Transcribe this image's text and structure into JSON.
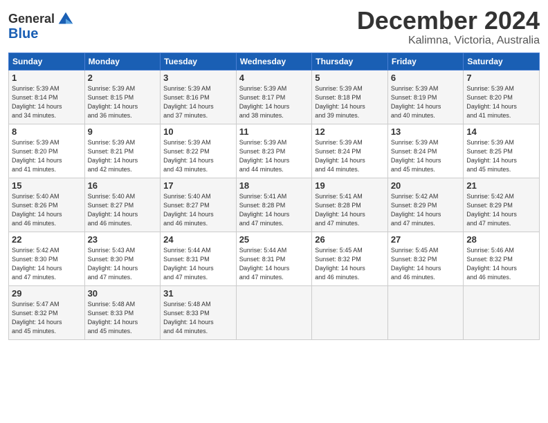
{
  "header": {
    "logo_line1": "General",
    "logo_line2": "Blue",
    "month": "December 2024",
    "location": "Kalimna, Victoria, Australia"
  },
  "days_of_week": [
    "Sunday",
    "Monday",
    "Tuesday",
    "Wednesday",
    "Thursday",
    "Friday",
    "Saturday"
  ],
  "weeks": [
    [
      {
        "day": 1,
        "info": "Sunrise: 5:39 AM\nSunset: 8:14 PM\nDaylight: 14 hours\nand 34 minutes."
      },
      {
        "day": 2,
        "info": "Sunrise: 5:39 AM\nSunset: 8:15 PM\nDaylight: 14 hours\nand 36 minutes."
      },
      {
        "day": 3,
        "info": "Sunrise: 5:39 AM\nSunset: 8:16 PM\nDaylight: 14 hours\nand 37 minutes."
      },
      {
        "day": 4,
        "info": "Sunrise: 5:39 AM\nSunset: 8:17 PM\nDaylight: 14 hours\nand 38 minutes."
      },
      {
        "day": 5,
        "info": "Sunrise: 5:39 AM\nSunset: 8:18 PM\nDaylight: 14 hours\nand 39 minutes."
      },
      {
        "day": 6,
        "info": "Sunrise: 5:39 AM\nSunset: 8:19 PM\nDaylight: 14 hours\nand 40 minutes."
      },
      {
        "day": 7,
        "info": "Sunrise: 5:39 AM\nSunset: 8:20 PM\nDaylight: 14 hours\nand 41 minutes."
      }
    ],
    [
      {
        "day": 8,
        "info": "Sunrise: 5:39 AM\nSunset: 8:20 PM\nDaylight: 14 hours\nand 41 minutes."
      },
      {
        "day": 9,
        "info": "Sunrise: 5:39 AM\nSunset: 8:21 PM\nDaylight: 14 hours\nand 42 minutes."
      },
      {
        "day": 10,
        "info": "Sunrise: 5:39 AM\nSunset: 8:22 PM\nDaylight: 14 hours\nand 43 minutes."
      },
      {
        "day": 11,
        "info": "Sunrise: 5:39 AM\nSunset: 8:23 PM\nDaylight: 14 hours\nand 44 minutes."
      },
      {
        "day": 12,
        "info": "Sunrise: 5:39 AM\nSunset: 8:24 PM\nDaylight: 14 hours\nand 44 minutes."
      },
      {
        "day": 13,
        "info": "Sunrise: 5:39 AM\nSunset: 8:24 PM\nDaylight: 14 hours\nand 45 minutes."
      },
      {
        "day": 14,
        "info": "Sunrise: 5:39 AM\nSunset: 8:25 PM\nDaylight: 14 hours\nand 45 minutes."
      }
    ],
    [
      {
        "day": 15,
        "info": "Sunrise: 5:40 AM\nSunset: 8:26 PM\nDaylight: 14 hours\nand 46 minutes."
      },
      {
        "day": 16,
        "info": "Sunrise: 5:40 AM\nSunset: 8:27 PM\nDaylight: 14 hours\nand 46 minutes."
      },
      {
        "day": 17,
        "info": "Sunrise: 5:40 AM\nSunset: 8:27 PM\nDaylight: 14 hours\nand 46 minutes."
      },
      {
        "day": 18,
        "info": "Sunrise: 5:41 AM\nSunset: 8:28 PM\nDaylight: 14 hours\nand 47 minutes."
      },
      {
        "day": 19,
        "info": "Sunrise: 5:41 AM\nSunset: 8:28 PM\nDaylight: 14 hours\nand 47 minutes."
      },
      {
        "day": 20,
        "info": "Sunrise: 5:42 AM\nSunset: 8:29 PM\nDaylight: 14 hours\nand 47 minutes."
      },
      {
        "day": 21,
        "info": "Sunrise: 5:42 AM\nSunset: 8:29 PM\nDaylight: 14 hours\nand 47 minutes."
      }
    ],
    [
      {
        "day": 22,
        "info": "Sunrise: 5:42 AM\nSunset: 8:30 PM\nDaylight: 14 hours\nand 47 minutes."
      },
      {
        "day": 23,
        "info": "Sunrise: 5:43 AM\nSunset: 8:30 PM\nDaylight: 14 hours\nand 47 minutes."
      },
      {
        "day": 24,
        "info": "Sunrise: 5:44 AM\nSunset: 8:31 PM\nDaylight: 14 hours\nand 47 minutes."
      },
      {
        "day": 25,
        "info": "Sunrise: 5:44 AM\nSunset: 8:31 PM\nDaylight: 14 hours\nand 47 minutes."
      },
      {
        "day": 26,
        "info": "Sunrise: 5:45 AM\nSunset: 8:32 PM\nDaylight: 14 hours\nand 46 minutes."
      },
      {
        "day": 27,
        "info": "Sunrise: 5:45 AM\nSunset: 8:32 PM\nDaylight: 14 hours\nand 46 minutes."
      },
      {
        "day": 28,
        "info": "Sunrise: 5:46 AM\nSunset: 8:32 PM\nDaylight: 14 hours\nand 46 minutes."
      }
    ],
    [
      {
        "day": 29,
        "info": "Sunrise: 5:47 AM\nSunset: 8:32 PM\nDaylight: 14 hours\nand 45 minutes."
      },
      {
        "day": 30,
        "info": "Sunrise: 5:48 AM\nSunset: 8:33 PM\nDaylight: 14 hours\nand 45 minutes."
      },
      {
        "day": 31,
        "info": "Sunrise: 5:48 AM\nSunset: 8:33 PM\nDaylight: 14 hours\nand 44 minutes."
      },
      null,
      null,
      null,
      null
    ]
  ]
}
